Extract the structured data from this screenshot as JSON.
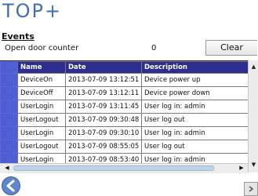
{
  "app": {
    "logo_text": "TOP+"
  },
  "events": {
    "title": "Events",
    "counter_label": "Open door counter",
    "counter_value": "0",
    "clear_label": "Clear"
  },
  "table": {
    "headers": [
      "Name",
      "Date",
      "Description"
    ],
    "rows": [
      {
        "name": "DeviceOn",
        "date": "2013-07-09 13:12:51",
        "desc": "Device power up"
      },
      {
        "name": "DeviceOff",
        "date": "2013-07-09 13:12:11",
        "desc": "Device power down"
      },
      {
        "name": "UserLogin",
        "date": "2013-07-09 13:11:45",
        "desc": "User log in: admin"
      },
      {
        "name": "UserLogout",
        "date": "2013-07-09 09:30:48",
        "desc": "User log out"
      },
      {
        "name": "UserLogin",
        "date": "2013-07-09 09:30:10",
        "desc": "User log in: admin"
      },
      {
        "name": "UserLogout",
        "date": "2013-07-09 08:55:05",
        "desc": "User log out"
      },
      {
        "name": "UserLogin",
        "date": "2013-07-09 08:53:40",
        "desc": "User log in: admin"
      }
    ]
  },
  "icons": {
    "back": "back-arrow-icon",
    "scroll_up": "triangle-up-icon",
    "scroll_down": "triangle-down-icon",
    "scroll_left": "triangle-left-icon",
    "scroll_right": "triangle-right-icon"
  },
  "colors": {
    "logo": "#3f6fb6",
    "header_bg": "#2d2d8f",
    "row_header_bg": "#4d5fd1"
  }
}
